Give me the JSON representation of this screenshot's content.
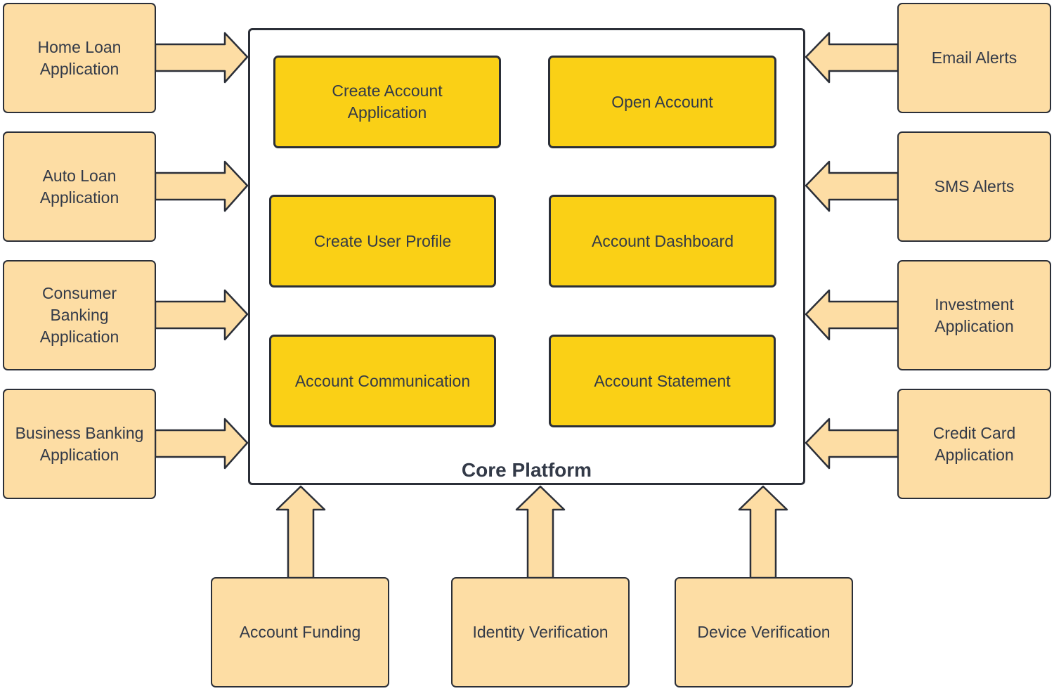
{
  "diagram": {
    "core": {
      "title": "Core Platform",
      "modules": [
        {
          "label": "Create Account\nApplication"
        },
        {
          "label": "Open Account"
        },
        {
          "label": "Create User Profile"
        },
        {
          "label": "Account Dashboard"
        },
        {
          "label": "Account Communication"
        },
        {
          "label": "Account Statement"
        }
      ]
    },
    "left_inputs": [
      {
        "label": "Home Loan\nApplication"
      },
      {
        "label": "Auto Loan\nApplication"
      },
      {
        "label": "Consumer\nBanking\nApplication"
      },
      {
        "label": "Business Banking\nApplication"
      }
    ],
    "right_inputs": [
      {
        "label": "Email Alerts"
      },
      {
        "label": "SMS Alerts"
      },
      {
        "label": "Investment\nApplication"
      },
      {
        "label": "Credit Card\nApplication"
      }
    ],
    "bottom_inputs": [
      {
        "label": "Account Funding"
      },
      {
        "label": "Identity Verification"
      },
      {
        "label": "Device Verification"
      }
    ],
    "colors": {
      "external_fill": "#fddda4",
      "module_fill": "#fad016",
      "stroke": "#2b2f38"
    }
  }
}
